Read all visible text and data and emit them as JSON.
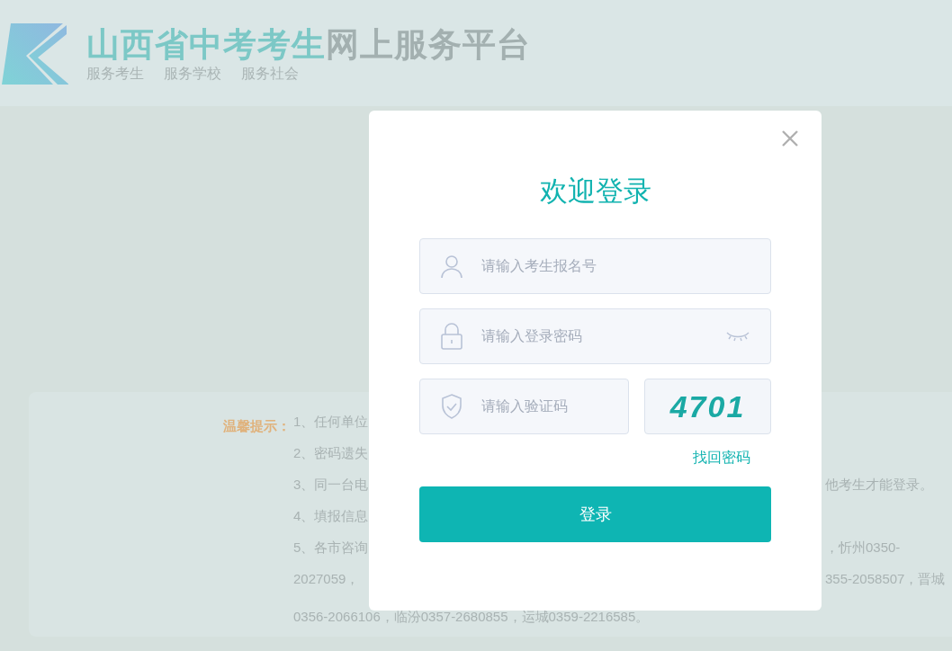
{
  "header": {
    "title_highlight": "山西省中考考生",
    "title_rest": "网上服务平台",
    "subtitles": [
      "服务考生",
      "服务学校",
      "服务社会"
    ]
  },
  "notice": {
    "title": "温馨提示：",
    "lines": [
      {
        "left": "1、任何单位"
      },
      {
        "left": "2、密码遗失"
      },
      {
        "left": "3、同一台电",
        "right": "他考生才能登录。"
      },
      {
        "left": "4、填报信息"
      },
      {
        "left": "5、各市咨询",
        "right": "，忻州0350-"
      },
      {
        "left": "2027059，",
        "right": "355-2058507，晋城"
      }
    ],
    "last_line": "0356-2066106，临汾0357-2680855，运城0359-2216585。"
  },
  "login": {
    "title": "欢迎登录",
    "username": {
      "placeholder": "请输入考生报名号"
    },
    "password": {
      "placeholder": "请输入登录密码"
    },
    "captcha": {
      "placeholder": "请输入验证码",
      "image_text": "4701"
    },
    "forgot_link": "找回密码",
    "submit": "登录"
  }
}
